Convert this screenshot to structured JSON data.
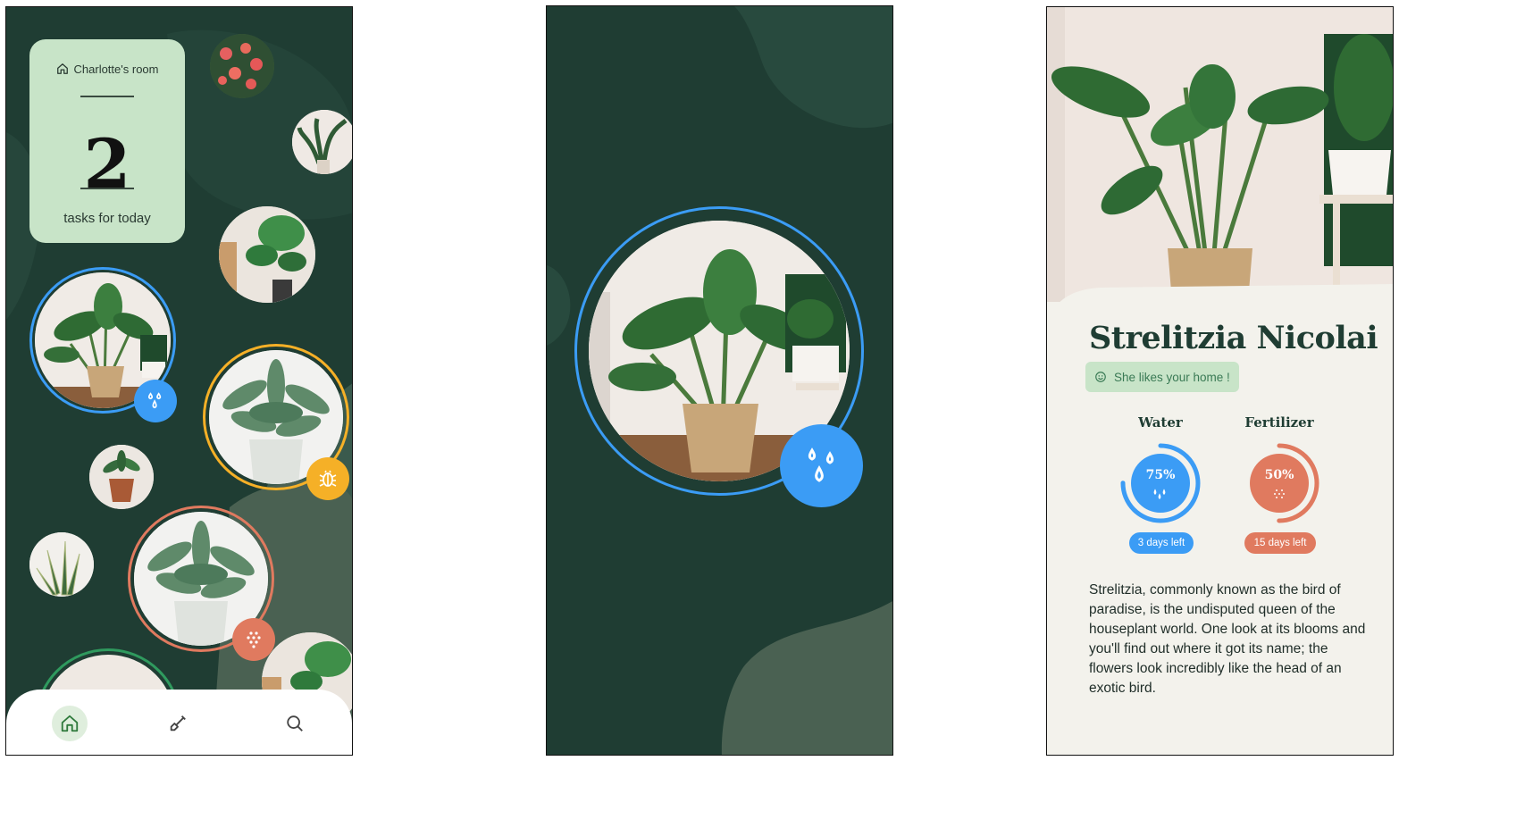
{
  "home": {
    "room_name": "Charlotte's room",
    "task_count": "2",
    "task_label": "tasks for today",
    "nav": [
      "home-icon",
      "shovel-icon",
      "search-icon"
    ]
  },
  "care_status": {
    "water": {
      "label": "Water",
      "percent_text": "75%",
      "level": 0.75,
      "days_left": "3 days left",
      "color": "#3b9cf5"
    },
    "fertilizer": {
      "label": "Fertilizer",
      "percent_text": "50%",
      "level": 0.5,
      "days_left": "15 days left",
      "color": "#e07a5f"
    }
  },
  "plant": {
    "name": "Strelitzia Nicolai",
    "mood": "She likes your home !",
    "description": "Strelitzia, commonly known as the bird of paradise, is the undisputed queen of the houseplant world. One look at its blooms and you'll find out where it got its name; the flowers look incredibly like the head of an exotic bird."
  },
  "colors": {
    "background": "#1f3d33",
    "water": "#3b9cf5",
    "pest": "#f5b027",
    "fertilizer": "#e07a5f",
    "card": "#c8e4c8"
  }
}
